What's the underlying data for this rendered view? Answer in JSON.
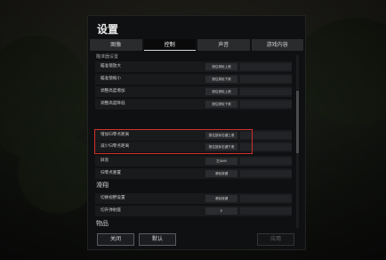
{
  "dialog": {
    "title": "设置",
    "tabs": [
      {
        "label": "图像"
      },
      {
        "label": "控制"
      },
      {
        "label": "声音"
      },
      {
        "label": "游戏内容"
      }
    ]
  },
  "sections": {
    "top_partial": "瞄准器设置",
    "glider": "滑翔",
    "items": "物品"
  },
  "rows": [
    {
      "label": "瞄准镜放大",
      "key": "按住滚轮上滚"
    },
    {
      "label": "瞄准镜缩小",
      "key": "按住滚轮下滚"
    },
    {
      "label": "调整高度增加",
      "key": "按住滚轮上滚"
    },
    {
      "label": "调整高度降低",
      "key": "按住滚轮下滚"
    },
    {
      "label": "增加归零点距离",
      "key": "按住鼠标右键上滚"
    },
    {
      "label": "减少归零点距离",
      "key": "按住鼠标右键下滚"
    },
    {
      "label": "屏息",
      "key": "左Shift"
    },
    {
      "label": "归零点重置",
      "key": "滚轮按键"
    },
    {
      "label": "切换视野设置",
      "key": "滚轮按键"
    },
    {
      "label": "切升弹射座",
      "key": "E"
    }
  ],
  "footer": {
    "close_label": "关闭",
    "default_label": "默认",
    "apply_label": "应用"
  },
  "colors": {
    "highlight_border": "#d0302b",
    "panel_bg": "#0f1012",
    "tab_active_underline": "#d8d8d8"
  }
}
